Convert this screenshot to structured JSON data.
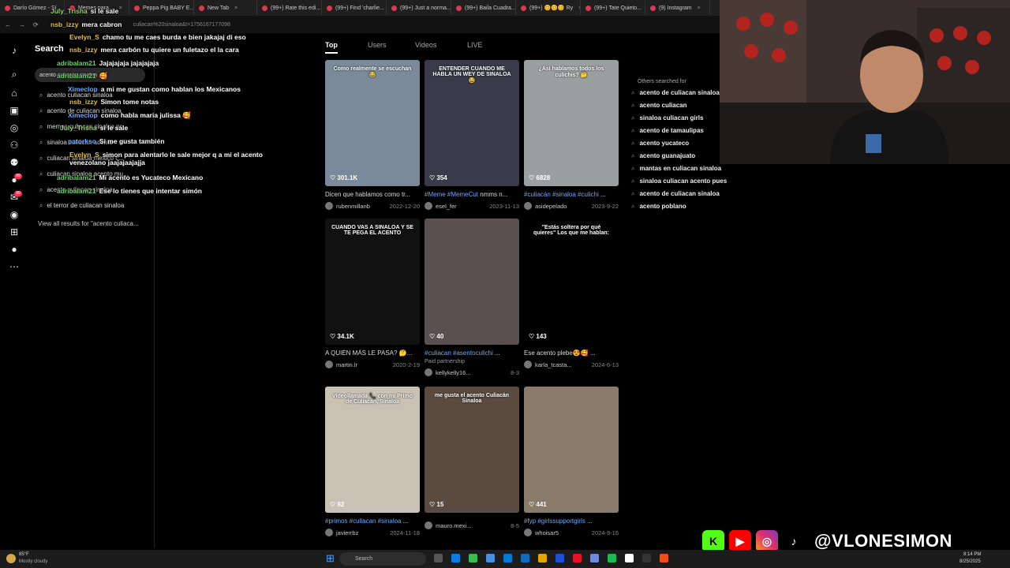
{
  "browser": {
    "tabs": [
      "Darío Gómez - Sí...",
      "Memes para...",
      "Peppa Pig BABY E...",
      "New Tab",
      "(99+) Rate this edi...",
      "(99+) Find 'charlie...",
      "(99+) Just a norma...",
      "(99+) Baila Cuadra...",
      "(99+) 😊😊😊 Ry",
      "(99+) Tate Quieto...",
      "(9) Instagram"
    ],
    "url": "culiacan%20sinaloa&t=1756167177098"
  },
  "search_panel": {
    "title": "Search",
    "query": "acento culiacan sinaloa",
    "suggestions": [
      "acento culiacan sinaloa",
      "acento de culiacan sinaloa",
      "memes culiacan sinaloa pc",
      "sinaloa culiacán acento",
      "culiacan sinaloa mexico c...",
      "culiacan sinaloa acento mu...",
      "acento culiacan sinaloa",
      "el terror de culiacan sinaloa"
    ],
    "view_all": "View all results for \"acento culiaca..."
  },
  "chat": [
    {
      "user": "July_Trisha",
      "msg": "si le sale",
      "color": "#9bd36b"
    },
    {
      "user": "nsb_izzy",
      "msg": "mera cabron",
      "color": "#e6c23a"
    },
    {
      "user": "Evelyn_S",
      "msg": "chamo tu me caes burda e bien jakajaj di eso",
      "color": "#e6c23a"
    },
    {
      "user": "nsb_izzy",
      "msg": "mera carbón tu quiere un fuletazo el la cara",
      "color": "#e6c23a"
    },
    {
      "user": "adribalam21",
      "msg": "Jajajajaja jajajajaja",
      "color": "#6fd36b"
    },
    {
      "user": "adribalam21",
      "msg": "🥰",
      "color": "#6fd36b"
    },
    {
      "user": "Ximeclop",
      "msg": "a mi me gustan como hablan los Mexicanos",
      "color": "#6fa8ff"
    },
    {
      "user": "nsb_izzy",
      "msg": "Simon tome notas",
      "color": "#e6c23a"
    },
    {
      "user": "Ximeclop",
      "msg": "como habla maria julissa 🥰",
      "color": "#6fa8ff"
    },
    {
      "user": "July_Trisha",
      "msg": "si le sale",
      "color": "#9bd36b"
    },
    {
      "user": "patorkso",
      "msg": "Si me gusta también",
      "color": "#6fa8ff"
    },
    {
      "user": "Evelyn_S",
      "msg": "simon para alentarlo le sale mejor q a mi el acento venezolano jaajajaajajja",
      "color": "#e6c23a"
    },
    {
      "user": "adribalam21",
      "msg": "Mi acento es Yucateco Mexicano",
      "color": "#6fd36b"
    },
    {
      "user": "adribalam21",
      "msg": "Ese lo tienes que intentar simón",
      "color": "#6fd36b"
    }
  ],
  "results_tabs": [
    "Top",
    "Users",
    "Videos",
    "LIVE"
  ],
  "videos": [
    {
      "overlay": "Como realmente se escuchan 😂",
      "likes": "301.1K",
      "caption_tag": "",
      "caption": "Dicen que hablamos como tr...",
      "user": "rubenmillanb",
      "date": "2022-12-20",
      "bg": "#7a8a9a"
    },
    {
      "overlay": "ENTENDER CUANDO ME HABLA UN WEY DE SINALOA 😂",
      "likes": "354",
      "caption_tag": "#Meme #MemeCut",
      "caption": " nmms n...",
      "user": "esel_fer",
      "date": "2023-11-13",
      "bg": "#3a3a4a"
    },
    {
      "overlay": "¿Así hablamos todos los culichis? 🤔",
      "likes": "6828",
      "caption_tag": "#culiacán #sinaloa #culichi",
      "caption": " ...",
      "user": "asidepelado",
      "date": "2023-9-22",
      "bg": "#9aa0a0"
    },
    {
      "overlay": "CUANDO VAS A SINALOA Y SE TE PEGA EL ACENTO",
      "likes": "34.1K",
      "caption_tag": "",
      "caption": "A QUIÉN MÁS LE PASA? 🤔...",
      "user": "martin.lr",
      "date": "2020-2-19",
      "bg": "#111"
    },
    {
      "overlay": "",
      "likes": "40",
      "caption_tag": "#culiacan #asentoculichi",
      "caption": " ...",
      "user": "kellykelly16...",
      "date": "8-3",
      "paid": "Paid partnership",
      "bg": "#5a5050"
    },
    {
      "overlay": "\"Estás soltera por qué quieres\" Los que me hablan:",
      "likes": "143",
      "caption_tag": "",
      "caption": "Ese acento plebe😍🥰 ...",
      "user": "karla_tcasta...",
      "date": "2024-6-13",
      "bg": "#000"
    },
    {
      "overlay": "Videollamada 📞 con mi Primo de Culiacán, Sinaloa",
      "likes": "92",
      "caption_tag": "#primos #culiacan #sinaloa",
      "caption": " ...",
      "user": "javierrbz",
      "date": "2024-11-18",
      "bg": "#c9c2b4"
    },
    {
      "overlay": "me gusta el acento Culiacán Sinaloa",
      "likes": "15",
      "caption_tag": "",
      "caption": "",
      "user": "mauro.mexi...",
      "date": "8-5",
      "bg": "#5a4a40"
    },
    {
      "overlay": "",
      "likes": "441",
      "caption_tag": "#fyp #girlssupportgirls",
      "caption": " ...",
      "user": "whoisar5",
      "date": "2024-9-16",
      "bg": "#8a7a6a"
    }
  ],
  "related": {
    "title": "Others searched for",
    "items": [
      "acento de culiacan sinaloa",
      "acento culiacan",
      "sinaloa culiacan girls",
      "acento de tamaulipas",
      "acento yucateco",
      "acento guanajuato",
      "mantas en culiacan sinaloa",
      "sinaloa culiacan acento pues",
      "acento de culiacan sinaloa",
      "acento poblano"
    ]
  },
  "overlay_branding": {
    "handle": "@VLONESIMON"
  },
  "taskbar": {
    "weather_temp": "85°F",
    "weather_desc": "Mostly cloudy",
    "search_placeholder": "Search",
    "time": "8:14 PM",
    "date": "8/25/2025"
  },
  "colors": {
    "accent": "#fe2c55",
    "hashtag": "#6fa8ff",
    "kick": "#53fc18",
    "youtube": "#ff0000"
  }
}
